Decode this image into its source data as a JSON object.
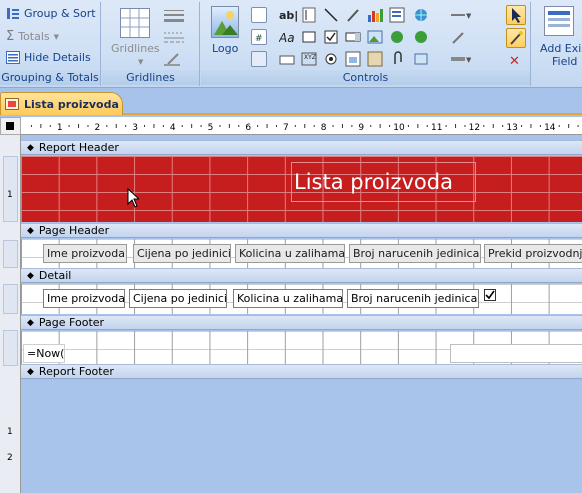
{
  "ribbon": {
    "grouping": {
      "group_sort": "Group & Sort",
      "totals": "Totals",
      "hide_details": "Hide Details",
      "label": "Grouping & Totals"
    },
    "gridlines": {
      "button": "Gridlines",
      "label": "Gridlines"
    },
    "controls": {
      "logo": "Logo",
      "label": "Controls"
    },
    "add_existing": {
      "line1": "Add Exis",
      "line2": "Field"
    }
  },
  "document": {
    "tab_title": "Lista proizvoda"
  },
  "bands": {
    "report_header": "Report Header",
    "page_header": "Page Header",
    "detail": "Detail",
    "page_footer": "Page Footer",
    "report_footer": "Report Footer"
  },
  "report_title": "Lista proizvoda",
  "page_header_labels": [
    "Ime proizvoda",
    "Cijena po jedinici",
    "Kolicina u zalihama",
    "Broj narucenih jedinica",
    "Prekid proizvodnje"
  ],
  "detail_fields": [
    "Ime proizvoda",
    "Cijena po jedinici",
    "Kolicina u zalihama",
    "Broj narucenih jedinica"
  ],
  "detail_checkbox_checked": true,
  "page_footer_expression": "=Now()",
  "hruler_numbers": [
    "1",
    "2",
    "3",
    "4",
    "5",
    "6",
    "7",
    "8",
    "9",
    "10",
    "11",
    "12",
    "13",
    "14"
  ],
  "vruler_numbers": [
    "1",
    "1",
    "2"
  ],
  "colors": {
    "header_fill": "#c61e1e",
    "tab_accent": "#ffc95a",
    "ribbon_text": "#15428b"
  }
}
